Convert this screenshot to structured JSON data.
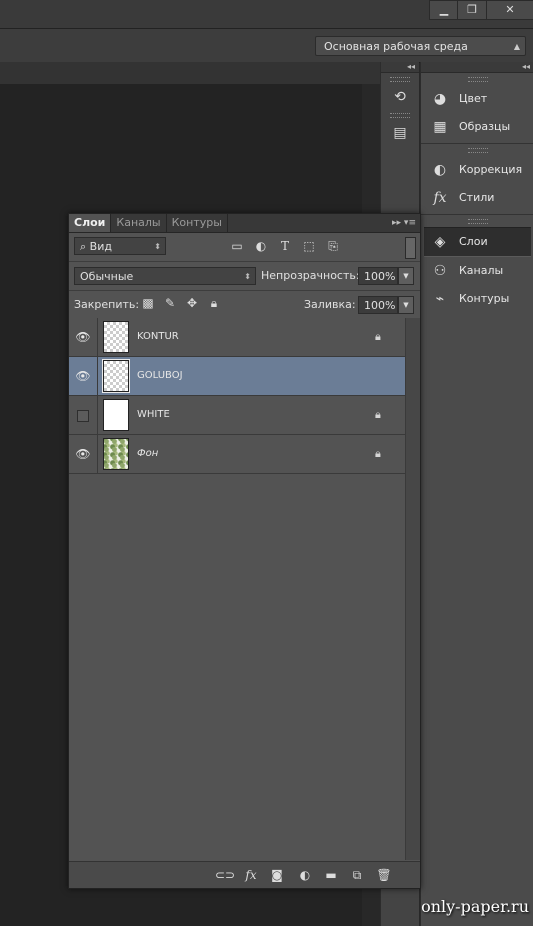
{
  "window": {
    "min": "▁",
    "restore": "❐",
    "close": "✕"
  },
  "options_bar": {
    "workspace": "Основная рабочая среда"
  },
  "dock": {
    "collapse_glyph": "◂◂",
    "strip_icons": [
      {
        "name": "history-icon",
        "glyph": "⟲"
      },
      {
        "name": "properties-icon",
        "glyph": "▤"
      }
    ],
    "groups": [
      [
        {
          "label": "Цвет",
          "icon": "palette-icon",
          "glyph": "◕"
        },
        {
          "label": "Образцы",
          "icon": "swatches-icon",
          "glyph": "▦"
        }
      ],
      [
        {
          "label": "Коррекция",
          "icon": "adjustments-icon",
          "glyph": "◐"
        },
        {
          "label": "Стили",
          "icon": "styles-icon",
          "glyph": "fx"
        }
      ],
      [
        {
          "label": "Слои",
          "icon": "layers-icon",
          "glyph": "◈",
          "active": true
        },
        {
          "label": "Каналы",
          "icon": "channels-icon",
          "glyph": "⚇"
        },
        {
          "label": "Контуры",
          "icon": "paths-icon",
          "glyph": "⌁"
        }
      ]
    ]
  },
  "layers_panel": {
    "tabs": [
      "Слои",
      "Каналы",
      "Контуры"
    ],
    "tab_menu": "▸▸ ▾≡",
    "filter": "⌕ Вид",
    "filter_icons": [
      "▭",
      "◐",
      "T",
      "⬚",
      "⎘"
    ],
    "blend_mode": "Обычные",
    "opacity_label": "Непрозрачность:",
    "opacity": "100%",
    "lock_label": "Закрепить:",
    "lock_icons": [
      "▩",
      "✎",
      "✥",
      "🔒︎"
    ],
    "fill_label": "Заливка:",
    "fill": "100%",
    "layers": [
      {
        "name": "KONTUR",
        "visible": true,
        "locked": true,
        "selected": false,
        "thumb": "trans",
        "italic": false
      },
      {
        "name": "GOLUBOJ",
        "visible": true,
        "locked": false,
        "selected": true,
        "thumb": "trans",
        "italic": false
      },
      {
        "name": "WHITE",
        "visible": false,
        "locked": true,
        "selected": false,
        "thumb": "white",
        "italic": false
      },
      {
        "name": "Фон",
        "visible": true,
        "locked": true,
        "selected": false,
        "thumb": "fon",
        "italic": true
      }
    ],
    "bottom_icons": [
      {
        "name": "link-icon",
        "glyph": "⊂⊃"
      },
      {
        "name": "fx-icon",
        "glyph": "fx"
      },
      {
        "name": "mask-icon",
        "glyph": "◙"
      },
      {
        "name": "adjustment-layer-icon",
        "glyph": "◐"
      },
      {
        "name": "folder-icon",
        "glyph": "▬"
      },
      {
        "name": "new-layer-icon",
        "glyph": "⧉"
      },
      {
        "name": "trash-icon",
        "glyph": "🗑︎"
      }
    ]
  },
  "watermark": "only-paper.ru"
}
